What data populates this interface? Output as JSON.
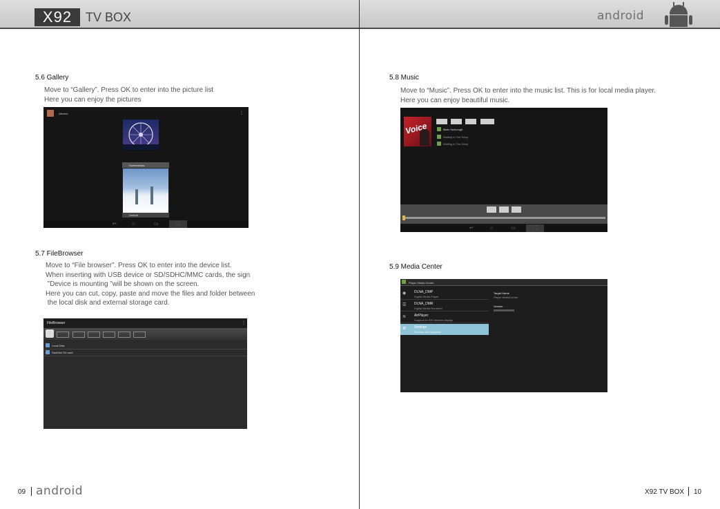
{
  "header": {
    "model": "X92",
    "subtitle": "TV BOX",
    "brand": "android"
  },
  "left": {
    "gallery": {
      "title": "5.6 Gallery",
      "text": "Move to “Gallery”. Press OK to enter into the picture list\nHere you can enjoy the pictures",
      "screen_title": "Albums",
      "folder1": "Screenshots",
      "folder2": "Default"
    },
    "filebrowser": {
      "title": "5.7 FileBrowser",
      "text": "Move to “File browser”. Press OK to enter into the device list.\nWhen inserting with USB device or SD/SDHC/MMC cards, the sign\n ”Device is mounting ”will be shown on the screen.\nHere you can cut, copy, paste and move the files and folder between\n the local disk and external storage card.",
      "screen_title": "FileBrowser",
      "items": [
        "Local Disk",
        "SanDisk SD card"
      ]
    },
    "footer": {
      "page": "09",
      "brand": "android"
    }
  },
  "right": {
    "music": {
      "title": "5.8 Music",
      "text": "Move to “Music”. Press OK to enter into the music list. This is for local media player.\nHere you can enjoy beautiful music.",
      "album_word": "Voice",
      "artist": "Blain Yarbrough",
      "tracks": [
        "Waiting in The Deep",
        "Waiting in The Deep"
      ]
    },
    "media_center": {
      "title": "5.9 Media Center",
      "screen_title": "Player Media Center",
      "items": [
        {
          "name": "DLNA_DMP",
          "sub": "Digital Media Player"
        },
        {
          "name": "DLNA_DMR",
          "sub": "Digital Media Renderer"
        },
        {
          "name": "AirPlayer",
          "sub": "Support for iOS devices display"
        },
        {
          "name": "Settings",
          "sub": "Rename and upgrade"
        }
      ],
      "target_label": "Target Name",
      "target_value": "Player MediaCenter",
      "version_label": "Version"
    },
    "footer": {
      "brand": "X92 TV BOX",
      "page": "10"
    }
  },
  "colors": {
    "header_bg": "#d0d0d0",
    "screen_bg": "#151515",
    "highlight": "#8ec3d8"
  }
}
